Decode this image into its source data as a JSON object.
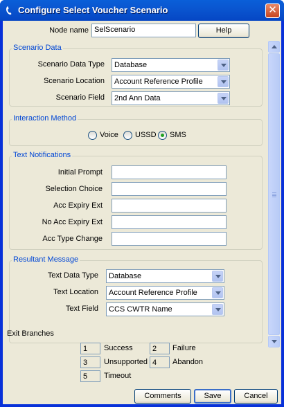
{
  "window": {
    "title": "Configure Select Voucher Scenario",
    "icon": "phone-handset-icon",
    "close_symbol": "✕"
  },
  "node": {
    "label": "Node name",
    "value": "SelScenario",
    "help_label": "Help"
  },
  "scenario_data": {
    "title": "Scenario Data",
    "data_type": {
      "label": "Scenario Data Type",
      "value": "Database"
    },
    "location": {
      "label": "Scenario Location",
      "value": "Account Reference Profile"
    },
    "field": {
      "label": "Scenario Field",
      "value": "2nd Ann Data"
    }
  },
  "interaction": {
    "title": "Interaction Method",
    "options": [
      {
        "label": "Voice",
        "checked": false
      },
      {
        "label": "USSD",
        "checked": false
      },
      {
        "label": "SMS",
        "checked": true
      }
    ]
  },
  "text_notifications": {
    "title": "Text Notifications",
    "fields": [
      "Initial Prompt",
      "Selection Choice",
      "Acc Expiry Ext",
      "No Acc Expiry Ext",
      "Acc Type Change"
    ]
  },
  "resultant": {
    "title": "Resultant Message",
    "data_type": {
      "label": "Text Data Type",
      "value": "Database"
    },
    "location": {
      "label": "Text Location",
      "value": "Account Reference Profile"
    },
    "field": {
      "label": "Text Field",
      "value": "CCS CWTR Name"
    }
  },
  "exit_branches": {
    "title": "Exit Branches",
    "items": [
      {
        "num": "1",
        "label": "Success"
      },
      {
        "num": "2",
        "label": "Failure"
      },
      {
        "num": "3",
        "label": "Unsupported"
      },
      {
        "num": "4",
        "label": "Abandon"
      },
      {
        "num": "5",
        "label": "Timeout"
      }
    ]
  },
  "buttons": {
    "comments": "Comments",
    "save": "Save",
    "cancel": "Cancel"
  },
  "colors": {
    "titlebar": "#0a5fd8",
    "group_title": "#0046d5",
    "radio_checked": "#21a121",
    "dialog_bg": "#ece9d8"
  }
}
